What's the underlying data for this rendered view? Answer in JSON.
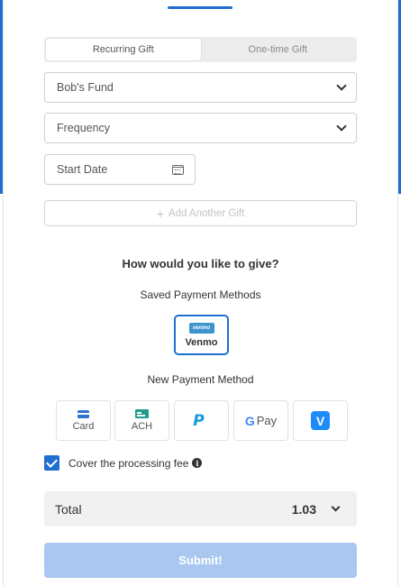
{
  "colors": {
    "accent": "#1f6fd1",
    "submit_disabled": "#aac8ef",
    "venmo": "#3d95ce"
  },
  "gift_type_tabs": [
    {
      "label": "Recurring Gift",
      "active": true
    },
    {
      "label": "One-time Gift",
      "active": false
    }
  ],
  "form": {
    "fund": {
      "value": "Bob's Fund",
      "icon": "chevron-down-icon"
    },
    "frequency": {
      "placeholder": "Frequency",
      "icon": "chevron-down-icon"
    },
    "start_date": {
      "placeholder": "Start Date",
      "icon": "calendar-icon"
    },
    "add_gift_label": "Add Another Gift"
  },
  "payment": {
    "heading": "How would you like to give?",
    "saved_label": "Saved Payment Methods",
    "saved_methods": [
      {
        "badge": "venmo",
        "label": "Venmo",
        "selected": true
      }
    ],
    "new_label": "New Payment Method",
    "new_methods": [
      {
        "id": "card",
        "label": "Card",
        "icon": "credit-card-icon"
      },
      {
        "id": "ach",
        "label": "ACH",
        "icon": "bank-ach-icon"
      },
      {
        "id": "paypal",
        "label": "",
        "logo": "P",
        "icon": "paypal-icon"
      },
      {
        "id": "gpay",
        "label": "Pay",
        "logo": "G",
        "icon": "google-pay-icon"
      },
      {
        "id": "venmo",
        "label": "",
        "logo": "V",
        "icon": "venmo-icon"
      }
    ]
  },
  "fee": {
    "label": "Cover the processing fee",
    "checked": true,
    "info": "i"
  },
  "total": {
    "label": "Total",
    "value": "1.03"
  },
  "submit": {
    "label": "Submit!"
  }
}
